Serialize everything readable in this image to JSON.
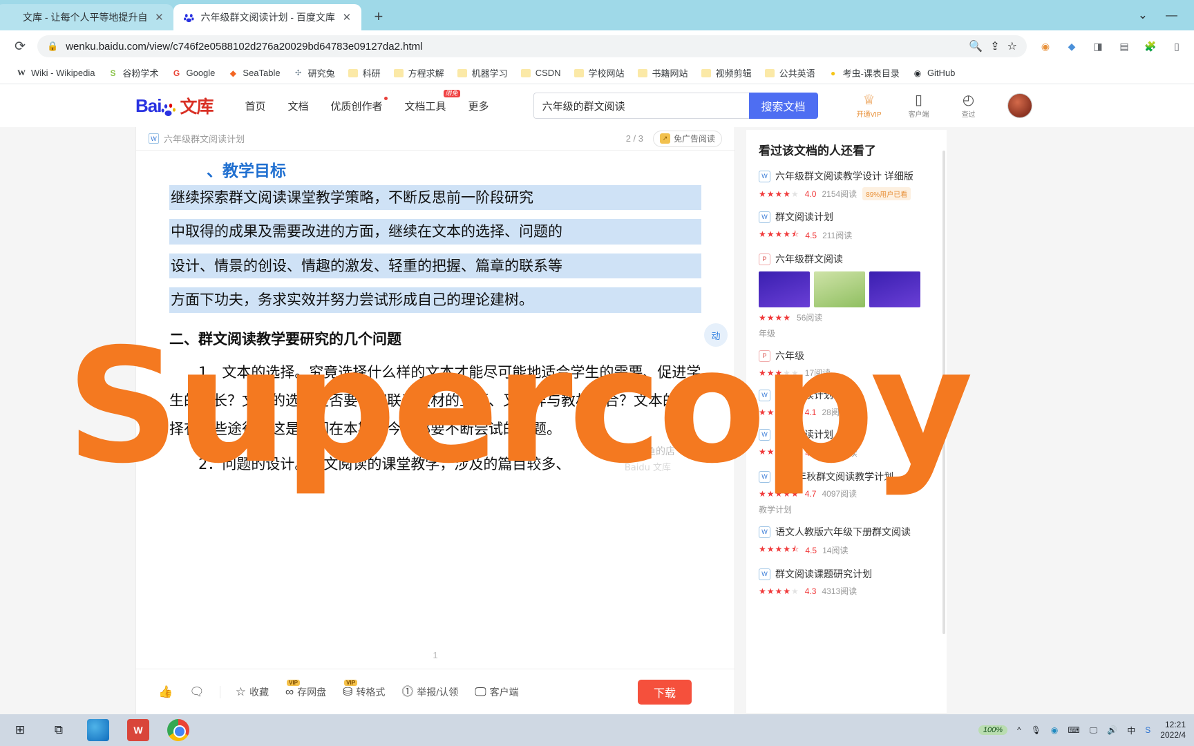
{
  "browser": {
    "tabs": [
      {
        "title": "文库 - 让每个人平等地提升自",
        "favicon": "page-icon",
        "active": false
      },
      {
        "title": "六年级群文阅读计划 - 百度文库",
        "favicon": "baidu-paw-icon",
        "active": true
      }
    ],
    "new_tab_label": "+",
    "window_controls": {
      "chevron": "⌄",
      "minimize": "—"
    },
    "reload_label": "⟳",
    "url": "wenku.baidu.com/view/c746f2e0588102d276a20029bd64783e09127da2.html",
    "lock_icon": "🔒",
    "omni_icons": [
      "magnifier",
      "share",
      "star"
    ],
    "ext_icons": [
      "puzzle-orange",
      "shield-blue",
      "send-gray",
      "reader-gray",
      "extensions",
      "sidepanel"
    ],
    "bookmarks": [
      {
        "label": "Wiki - Wikipedia",
        "icon": "W"
      },
      {
        "label": "谷粉学术",
        "icon": "S"
      },
      {
        "label": "Google",
        "icon": "G"
      },
      {
        "label": "SeaTable",
        "icon": "◆"
      },
      {
        "label": "研究兔",
        "icon": "🐰"
      },
      {
        "label": "科研",
        "icon": "folder"
      },
      {
        "label": "方程求解",
        "icon": "folder"
      },
      {
        "label": "机器学习",
        "icon": "folder"
      },
      {
        "label": "CSDN",
        "icon": "folder"
      },
      {
        "label": "学校网站",
        "icon": "folder"
      },
      {
        "label": "书籍网站",
        "icon": "folder"
      },
      {
        "label": "视频剪辑",
        "icon": "folder"
      },
      {
        "label": "公共英语",
        "icon": "folder"
      },
      {
        "label": "考虫-课表目录",
        "icon": "😀"
      },
      {
        "label": "GitHub",
        "icon": ""
      }
    ]
  },
  "wenku": {
    "logo": {
      "bai": "Bai",
      "du": "du",
      "wenku": "文库"
    },
    "nav": [
      {
        "label": "首页"
      },
      {
        "label": "文档"
      },
      {
        "label": "优质创作者",
        "dot": true
      },
      {
        "label": "文档工具",
        "badge": "限免"
      },
      {
        "label": "更多"
      }
    ],
    "search": {
      "value": "六年级的群文阅读",
      "placeholder": "搜索文档",
      "button": "搜索文档"
    },
    "right_items": [
      {
        "label": "开通VIP",
        "icon": "vip-crown-icon",
        "vip": true
      },
      {
        "label": "客户端",
        "icon": "phone-icon",
        "vip": false
      },
      {
        "label": "查过",
        "icon": "clock-icon",
        "vip": false
      }
    ],
    "avatar": "user-avatar"
  },
  "doc": {
    "toolbar": {
      "format_icon": "W",
      "title": "六年级群文阅读计划",
      "page_indicator": "2 / 3",
      "adfree_label": "免广告阅读",
      "adfree_icon": "ad-free-icon"
    },
    "content": {
      "heading_partial": "、教学目标",
      "highlighted_lines": [
        "继续探索群文阅读课堂教学策略，不断反思前一阶段研究",
        "中取得的成果及需要改进的方面，继续在文本的选择、问题的",
        "设计、情景的创设、情趣的激发、轻重的把握、篇章的联系等",
        "方面下功夫，务求实效并努力尝试形成自己的理论建树。"
      ],
      "section_heading": "二、群文阅读教学要研究的几个问题",
      "paragraphs": [
        "1．文本的选择。究竟选择什么样的文本才能尽可能地适合学生的需要、促进学生的成长？文本的选择是否要密切联系教材的主题、又怎样与教材整合？文本的选择有哪些途径？这是我们在本期及今后都要不断尝试的问题。",
        "2．问题的设计。群文阅读的课堂教学，涉及的篇目较多、"
      ],
      "page_number": "1",
      "watermark_shop": "@有鱼的店",
      "watermark_brand": "Baidu 文库"
    },
    "footer": {
      "actions": [
        {
          "label": "",
          "icon": "thumbs-up-icon",
          "vip": false
        },
        {
          "label": "",
          "icon": "comment-icon",
          "vip": false
        },
        {
          "label": "收藏",
          "icon": "star-icon",
          "vip": false
        },
        {
          "label": "存网盘",
          "icon": "cloud-disk-icon",
          "vip": true
        },
        {
          "label": "转格式",
          "icon": "convert-icon",
          "vip": true
        },
        {
          "label": "举报/认领",
          "icon": "report-icon",
          "vip": false
        },
        {
          "label": "客户端",
          "icon": "monitor-icon",
          "vip": false
        }
      ],
      "download_label": "下载"
    },
    "float_button": "动"
  },
  "recommend": {
    "title": "看过该文档的人还看了",
    "items": [
      {
        "name": "六年级群文阅读教学设计 详细版",
        "format": "W",
        "stars_full": 4,
        "stars_half": 0,
        "score": "4.0",
        "reads": "2154阅读",
        "badge": "89%用户已看",
        "sub": "",
        "thumbs": false
      },
      {
        "name": "群文阅读计划",
        "format": "W",
        "stars_full": 4,
        "stars_half": 1,
        "score": "4.5",
        "reads": "211阅读",
        "badge": "",
        "sub": "",
        "thumbs": false
      },
      {
        "name": "六年级群文阅读",
        "format": "P",
        "stars_full": 4,
        "stars_half": 0,
        "score": "",
        "reads": "56阅读",
        "badge": "",
        "sub": "年级",
        "thumbs": true
      },
      {
        "name": "六年级",
        "format": "P",
        "stars_full": 3,
        "stars_half": 0,
        "score": "",
        "reads": "17阅读",
        "badge": "",
        "sub": "",
        "thumbs": false
      },
      {
        "name": "群文阅读计划",
        "format": "W",
        "stars_full": 4,
        "stars_half": 0,
        "score": "4.1",
        "reads": "28阅读",
        "badge": "",
        "sub": "",
        "thumbs": false
      },
      {
        "name": "群文阅读计划",
        "format": "W",
        "stars_full": 4,
        "stars_half": 1,
        "score": "4.5",
        "reads": "1645阅读",
        "badge": "",
        "sub": "",
        "thumbs": false
      },
      {
        "name": "2015年秋群文阅读教学计划",
        "format": "W",
        "stars_full": 5,
        "stars_half": 0,
        "score": "4.7",
        "reads": "4097阅读",
        "badge": "",
        "sub": "教学计划",
        "thumbs": false
      },
      {
        "name": "语文人教版六年级下册群文阅读",
        "format": "W",
        "stars_full": 4,
        "stars_half": 1,
        "score": "4.5",
        "reads": "14阅读",
        "badge": "",
        "sub": "",
        "thumbs": false
      },
      {
        "name": "群文阅读课题研究计划",
        "format": "W",
        "stars_full": 4,
        "stars_half": 0,
        "score": "4.3",
        "reads": "4313阅读",
        "badge": "",
        "sub": "",
        "thumbs": false
      }
    ]
  },
  "watermark": {
    "text": "Supercopy",
    "color": "#f47920"
  },
  "taskbar": {
    "left_icons": [
      "windows-start-icon",
      "task-view-icon"
    ],
    "apps": [
      "edge-icon",
      "wps-icon",
      "chrome-icon"
    ],
    "tray": [
      "chevron-up",
      "mic",
      "edge-tray",
      "keyboard",
      "display",
      "volume",
      "ime-cn",
      "s-icon"
    ],
    "battery": "100%",
    "clock_time": "12:21",
    "clock_date": "2022/4"
  }
}
